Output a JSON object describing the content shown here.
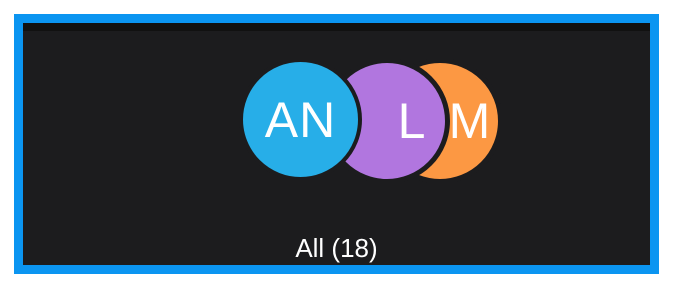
{
  "group": {
    "avatars": [
      {
        "initials": "AN",
        "color": "#27aee8"
      },
      {
        "initials": "L",
        "color": "#b176df"
      },
      {
        "initials": "M",
        "color": "#fc9843"
      }
    ],
    "label": "All (18)"
  },
  "colors": {
    "frame_border": "#0b95f1",
    "background": "#1c1c1e"
  }
}
